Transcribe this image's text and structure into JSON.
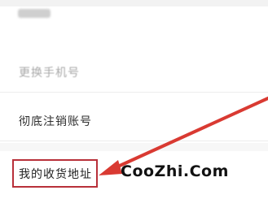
{
  "menu": {
    "items": [
      {
        "label": "更换手机号"
      },
      {
        "label": "彻底注销账号"
      },
      {
        "label": "我的收货地址"
      }
    ]
  },
  "watermark": {
    "text": "CooZhi.Com"
  },
  "annotation": {
    "arrow_color": "#d93a32",
    "highlight_color": "#b8303a"
  }
}
